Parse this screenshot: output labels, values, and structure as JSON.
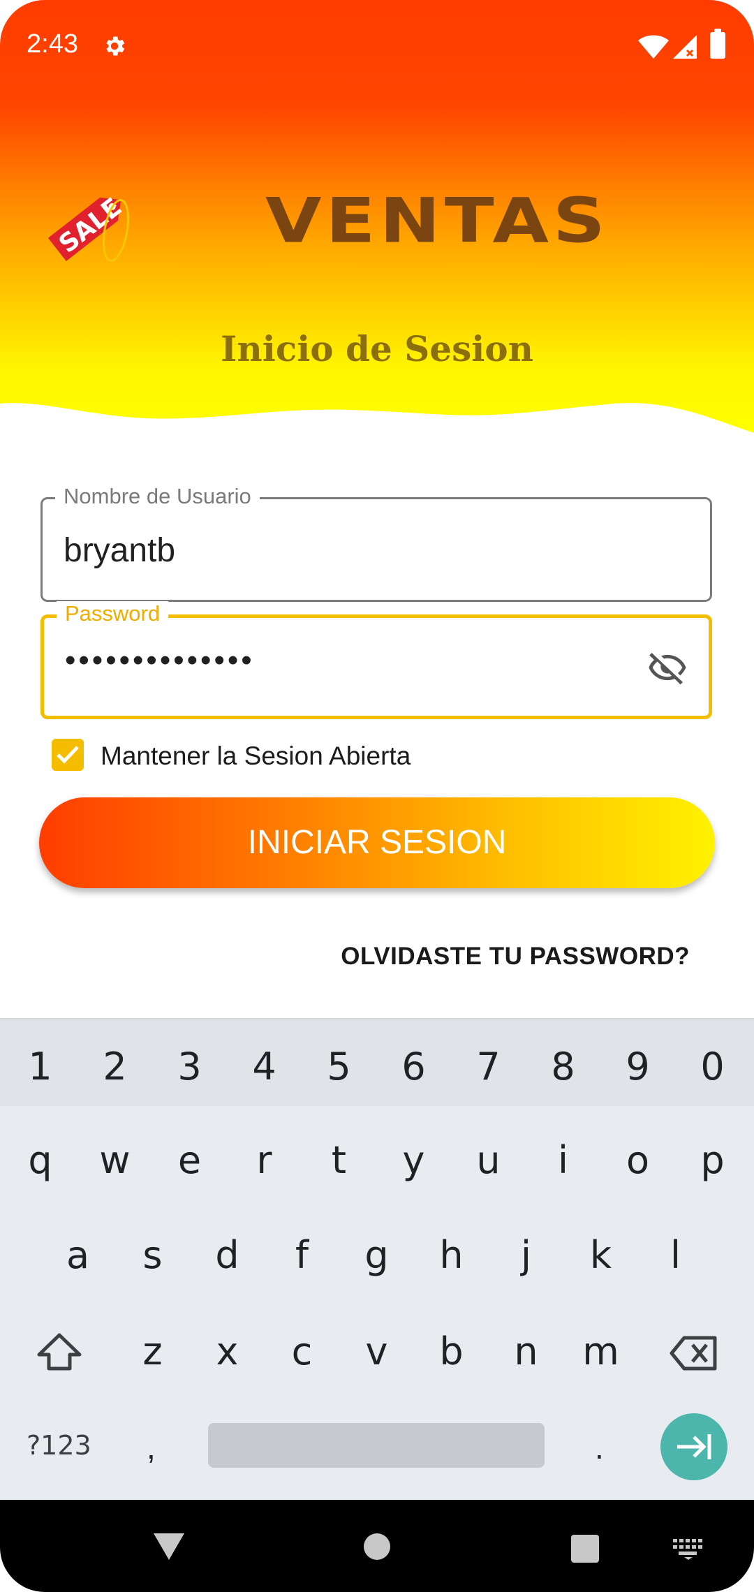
{
  "status_bar": {
    "time": "2:43",
    "icons": [
      "gear-icon",
      "wifi-icon",
      "signal-icon",
      "battery-icon"
    ]
  },
  "header": {
    "logo_icon": "sale-tag-icon",
    "logo_text": "SALE",
    "app_title": "VENTAS",
    "subtitle": "Inicio de Sesion",
    "colors": {
      "top": "#ff4200",
      "bottom": "#fff700",
      "title": "#7a4510",
      "subtitle": "#8a6f0c"
    }
  },
  "form": {
    "username": {
      "label": "Nombre de Usuario",
      "value": "bryantb"
    },
    "password": {
      "label": "Password",
      "value": "••••••••••••••",
      "toggle_icon": "eye-off-icon"
    },
    "keep_session": {
      "label": "Mantener la Sesion Abierta",
      "checked": true
    },
    "login_button": "INICIAR SESION",
    "forgot_link": "OLVIDASTE TU PASSWORD?"
  },
  "keyboard": {
    "numbers": [
      "1",
      "2",
      "3",
      "4",
      "5",
      "6",
      "7",
      "8",
      "9",
      "0"
    ],
    "row1": [
      "q",
      "w",
      "e",
      "r",
      "t",
      "y",
      "u",
      "i",
      "o",
      "p"
    ],
    "row2": [
      "a",
      "s",
      "d",
      "f",
      "g",
      "h",
      "j",
      "k",
      "l"
    ],
    "row3": [
      "z",
      "x",
      "c",
      "v",
      "b",
      "n",
      "m"
    ],
    "symbols_key": "?123",
    "comma_key": ",",
    "period_key": ".",
    "shift_icon": "shift-icon",
    "backspace_icon": "backspace-icon",
    "enter_icon": "next-arrow-icon"
  },
  "navbar": {
    "icons": [
      "back-icon",
      "home-icon",
      "recents-icon",
      "keyboard-switch-icon"
    ]
  }
}
